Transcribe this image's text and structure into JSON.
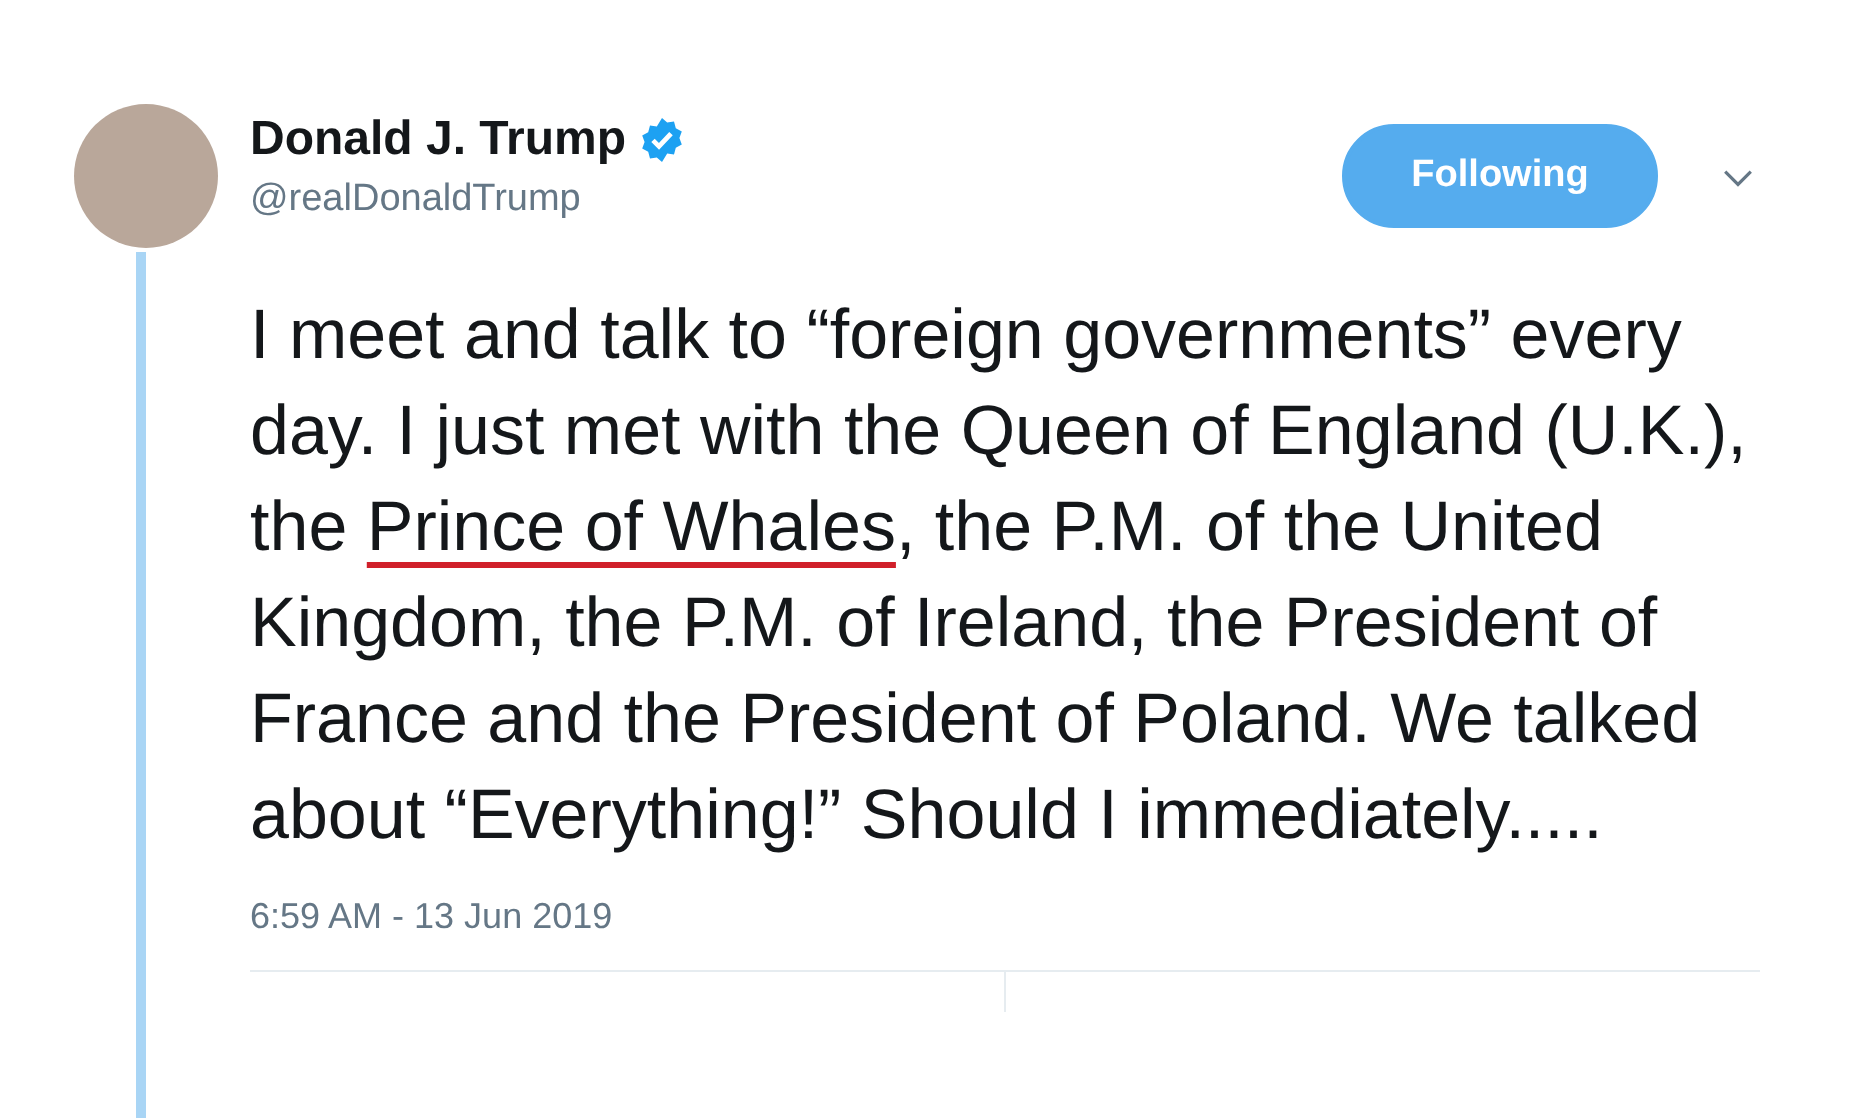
{
  "tweet": {
    "author": {
      "name": "Donald J. Trump",
      "verified": true,
      "handle": "@realDonaldTrump"
    },
    "follow_button": {
      "label": "Following",
      "following": true
    },
    "text": [
      {
        "text": "I meet and talk to “foreign governments” every day. I just met with the Queen of England (U.K.), the ",
        "underlined": false
      },
      {
        "text": "Prince of Whales",
        "underlined": true
      },
      {
        "text": ", the P.M. of the United Kingdom, the P.M. of Ireland, the President of France and the President of Poland. We talked about “Everything!” Should I immediately.....",
        "underlined": false
      }
    ],
    "timestamp": "6:59 AM - 13 Jun 2019"
  }
}
